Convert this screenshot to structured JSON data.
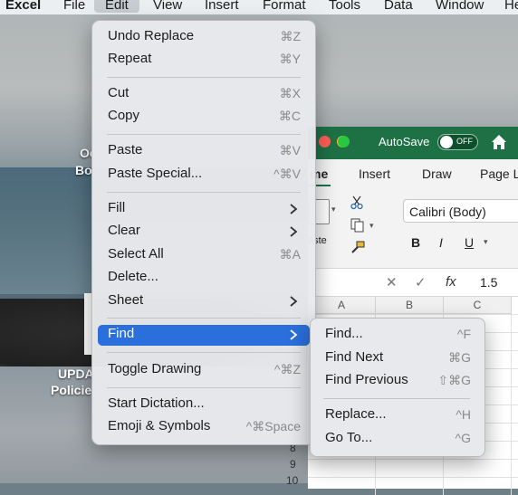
{
  "menubar": {
    "app_name": "Excel",
    "items": [
      "File",
      "Edit",
      "View",
      "Insert",
      "Format",
      "Tools",
      "Data",
      "Window",
      "He"
    ]
  },
  "desktop": {
    "labels": [
      "Oc",
      "Bo",
      "UPDA",
      "Policie"
    ]
  },
  "edit_menu": {
    "items": [
      {
        "label": "Undo Replace",
        "shortcut": "⌘Z"
      },
      {
        "label": "Repeat",
        "shortcut": "⌘Y"
      },
      {
        "label": "Cut",
        "shortcut": "⌘X"
      },
      {
        "label": "Copy",
        "shortcut": "⌘C"
      },
      {
        "label": "Paste",
        "shortcut": "⌘V"
      },
      {
        "label": "Paste Special...",
        "shortcut": "^⌘V"
      },
      {
        "label": "Fill",
        "shortcut": ""
      },
      {
        "label": "Clear",
        "shortcut": ""
      },
      {
        "label": "Select All",
        "shortcut": "⌘A"
      },
      {
        "label": "Delete...",
        "shortcut": ""
      },
      {
        "label": "Sheet",
        "shortcut": ""
      },
      {
        "label": "Find",
        "shortcut": ""
      },
      {
        "label": "Toggle Drawing",
        "shortcut": "^⌘Z"
      },
      {
        "label": "Start Dictation...",
        "shortcut": ""
      },
      {
        "label": "Emoji & Symbols",
        "shortcut": "^⌘Space"
      }
    ]
  },
  "find_submenu": {
    "items": [
      {
        "label": "Find...",
        "shortcut": "^F"
      },
      {
        "label": "Find Next",
        "shortcut": "⌘G"
      },
      {
        "label": "Find Previous",
        "shortcut": "⇧⌘G"
      },
      {
        "label": "Replace...",
        "shortcut": "^H"
      },
      {
        "label": "Go To...",
        "shortcut": "^G"
      }
    ]
  },
  "excel": {
    "autosave_label": "AutoSave",
    "autosave_state": "OFF",
    "ribbon_tabs": [
      "me",
      "Insert",
      "Draw",
      "Page L"
    ],
    "paste_label": "aste",
    "font_name": "Calibri (Body)",
    "format_buttons": [
      "B",
      "I",
      "U"
    ],
    "formula_value": "1.5",
    "columns": [
      "A",
      "B",
      "C"
    ],
    "row_numbers": [
      "8",
      "9",
      "10"
    ],
    "colors": {
      "titlebar": "#1e7145",
      "accent": "#2a6fdc"
    }
  }
}
